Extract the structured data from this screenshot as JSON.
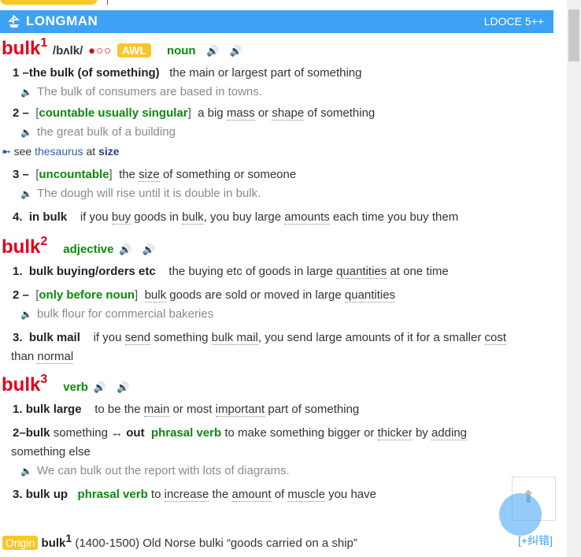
{
  "header": {
    "brand": "LONGMAN",
    "edition": "LDOCE 5++",
    "logo_icon": "ship-icon"
  },
  "entries": [
    {
      "headword": "bulk",
      "homnum": "1",
      "pron": "/bʌlk/",
      "freq": "●○○",
      "awl": "AWL",
      "pos": "noun",
      "senses": [
        {
          "num": "1",
          "lex": "the bulk (of something)",
          "def": "the main or largest part of something",
          "example": "The bulk of consumers are based in towns."
        },
        {
          "num": "2",
          "gram": "countable usually singular",
          "def_parts": [
            "a big ",
            "mass",
            " or ",
            "shape",
            " of something"
          ],
          "example": "the great bulk of a building",
          "xref": {
            "see": "see",
            "link": "thesaurus",
            "at": "at",
            "target": "size"
          }
        },
        {
          "num": "3",
          "gram": "uncountable",
          "def_parts": [
            "the ",
            "size",
            " of something or someone"
          ],
          "example": "The dough will rise until it is double in bulk."
        },
        {
          "num": "4",
          "lex": "in bulk",
          "def_parts": [
            "if you ",
            "buy",
            " goods in ",
            "bulk",
            ", you buy large ",
            "amounts",
            " each time you buy them"
          ]
        }
      ]
    },
    {
      "headword": "bulk",
      "homnum": "2",
      "pos": "adjective",
      "senses": [
        {
          "num": "1",
          "lex": "bulk buying/orders etc",
          "def_parts": [
            "the buying etc of goods in large ",
            "quantities",
            " at one time"
          ]
        },
        {
          "num": "2",
          "gram": "only before noun",
          "def_parts": [
            "bulk",
            " goods are sold or moved in large ",
            "quantities"
          ],
          "example": "bulk flour for commercial bakeries"
        },
        {
          "num": "3",
          "lex": "bulk mail",
          "def_parts": [
            "if you ",
            "send",
            " something ",
            "bulk mail",
            ", you send large amounts of it for a smaller ",
            "cost"
          ],
          "def_cont": "than ",
          "def_cont_u": "normal"
        }
      ]
    },
    {
      "headword": "bulk",
      "homnum": "3",
      "pos": "verb",
      "senses": [
        {
          "num": "1",
          "lex": "bulk large",
          "def_parts": [
            "to be the ",
            "main",
            " or most ",
            "important",
            " part of something"
          ]
        },
        {
          "num": "2",
          "lex": "bulk",
          "lex_plain": " something ↔ ",
          "lex2": "out",
          "gram2": "phrasal verb",
          "def_parts": [
            "to make something bigger or ",
            "thicker",
            " by ",
            "adding"
          ],
          "def_cont": "something else",
          "example": "We can bulk out the report with lots of diagrams."
        },
        {
          "num": "3",
          "lex": "bulk up",
          "gram2": "phrasal verb",
          "def_parts": [
            "to ",
            "increase",
            " the ",
            "amount",
            " of ",
            "muscle",
            " you have"
          ]
        }
      ]
    }
  ],
  "origin": {
    "tag": "Origin",
    "headword": "bulk",
    "homnum": "1",
    "text": "(1400-1500) Old Norse bulki “goods carried on a ship”"
  },
  "feedback": "[+纠错]"
}
